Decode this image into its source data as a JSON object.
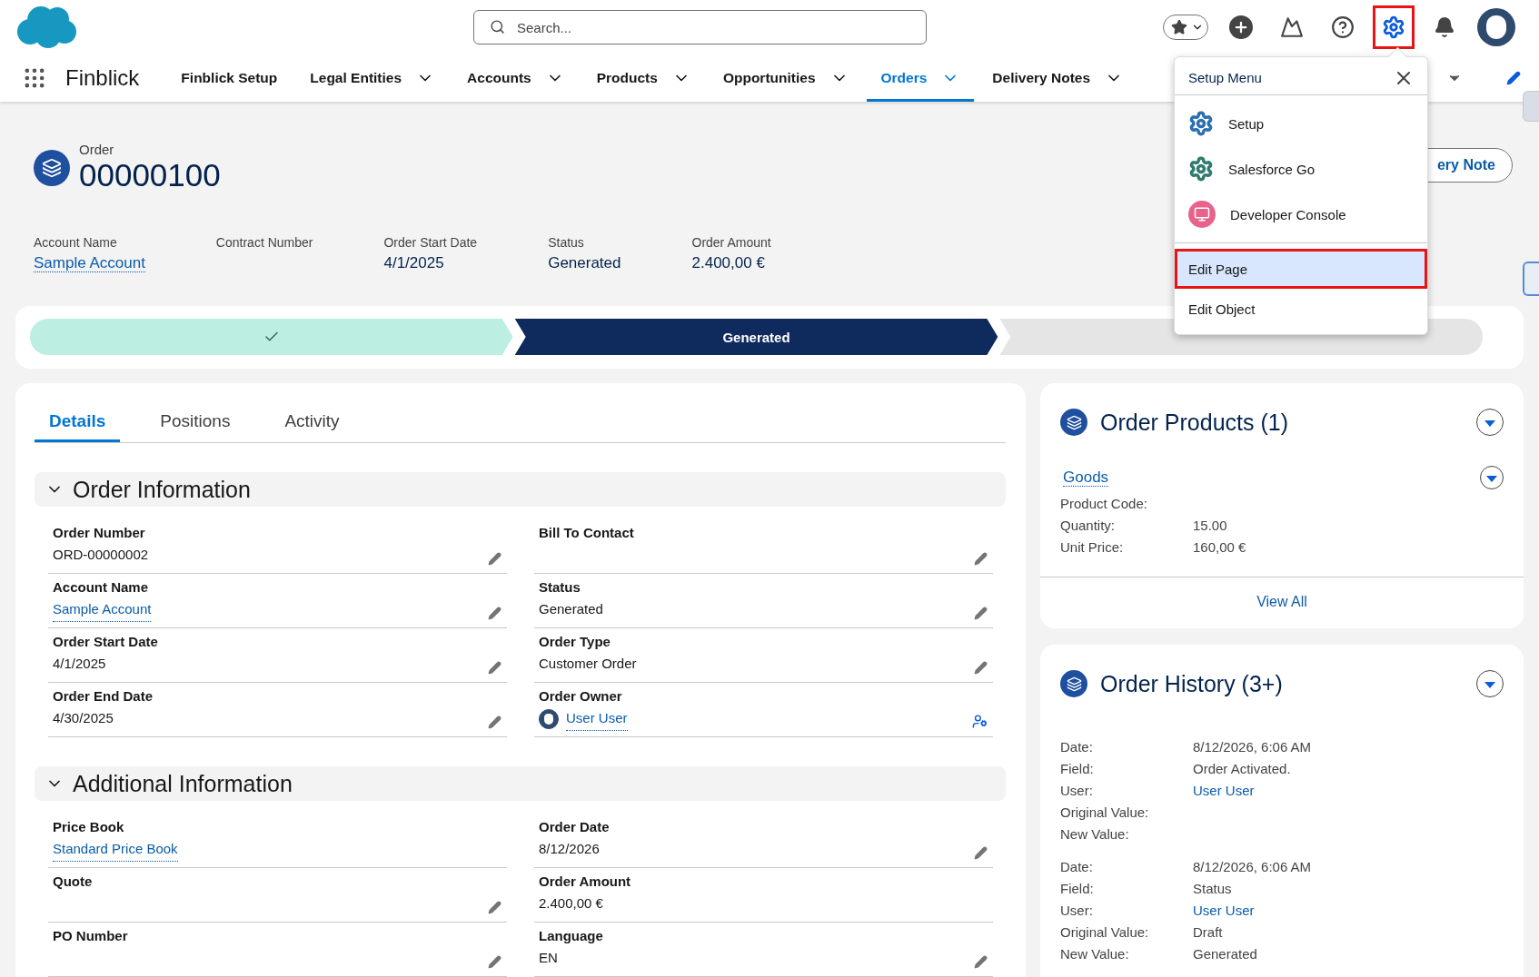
{
  "header": {
    "search": {
      "placeholder": "Search..."
    },
    "setup_highlighted": true
  },
  "nav": {
    "app_name": "Finblick",
    "items": [
      {
        "label": "Finblick Setup",
        "has_menu": false,
        "selected": false
      },
      {
        "label": "Legal Entities",
        "has_menu": true,
        "selected": false
      },
      {
        "label": "Accounts",
        "has_menu": true,
        "selected": false
      },
      {
        "label": "Products",
        "has_menu": true,
        "selected": false
      },
      {
        "label": "Opportunities",
        "has_menu": true,
        "selected": false
      },
      {
        "label": "Orders",
        "has_menu": true,
        "selected": true
      },
      {
        "label": "Delivery Notes",
        "has_menu": true,
        "selected": false
      }
    ]
  },
  "record": {
    "type": "Order",
    "number": "00000100",
    "action": "ery Note",
    "highlights": [
      {
        "label": "Account Name",
        "value": "Sample Account",
        "kind": "link"
      },
      {
        "label": "Contract Number",
        "kind": "empty"
      },
      {
        "label": "Order Start Date",
        "value": "4/1/2025",
        "kind": "text"
      },
      {
        "label": "Status",
        "value": "Generated",
        "kind": "text"
      },
      {
        "label": "Order Amount",
        "value": "2.400,00 €",
        "kind": "text"
      }
    ]
  },
  "path": [
    {
      "complete": true,
      "current": false
    },
    {
      "complete": false,
      "current": true,
      "label": "Generated"
    },
    {
      "complete": false,
      "current": false
    }
  ],
  "tabs": [
    {
      "label": "Details",
      "selected": true
    },
    {
      "label": "Positions",
      "selected": false
    },
    {
      "label": "Activity",
      "selected": false
    }
  ],
  "sections": [
    {
      "title": "Order Information",
      "expanded": true,
      "fields": [
        {
          "label": "Order Number",
          "value": "ORD-00000002",
          "kind": "text",
          "editable": true
        },
        {
          "label": "Bill To Contact",
          "kind": "empty",
          "editable": true
        },
        {
          "label": "Account Name",
          "value": "Sample Account",
          "kind": "link",
          "editable": true
        },
        {
          "label": "Status",
          "value": "Generated",
          "kind": "text",
          "editable": true
        },
        {
          "label": "Order Start Date",
          "value": "4/1/2025",
          "kind": "text",
          "editable": true
        },
        {
          "label": "Order Type",
          "value": "Customer Order",
          "kind": "text",
          "editable": true
        },
        {
          "label": "Order End Date",
          "value": "4/30/2025",
          "kind": "text",
          "editable": true
        },
        {
          "label": "Order Owner",
          "value": "User User",
          "kind": "user",
          "editable": true
        }
      ]
    },
    {
      "title": "Additional Information",
      "expanded": true,
      "fields": [
        {
          "label": "Price Book",
          "value": "Standard Price Book",
          "kind": "link",
          "editable": false
        },
        {
          "label": "Order Date",
          "value": "8/12/2026",
          "kind": "text",
          "editable": true
        },
        {
          "label": "Quote",
          "kind": "empty",
          "editable": true
        },
        {
          "label": "Order Amount",
          "value": "2.400,00 €",
          "kind": "text",
          "editable": false
        },
        {
          "label": "PO Number",
          "kind": "empty",
          "editable": true
        },
        {
          "label": "Language",
          "value": "EN",
          "kind": "text",
          "editable": true
        }
      ]
    }
  ],
  "order_products": {
    "title": "Order Products (1)",
    "items": [
      {
        "name": "Goods",
        "fields": [
          {
            "label": "Product Code:",
            "kind": "empty"
          },
          {
            "label": "Quantity:",
            "value": "15.00",
            "kind": "text"
          },
          {
            "label": "Unit Price:",
            "value": "160,00 €",
            "kind": "text"
          }
        ]
      }
    ],
    "footer": "View All"
  },
  "order_history": {
    "title": "Order History (3+)",
    "entries": [
      {
        "fields": [
          {
            "label": "Date:",
            "value": "8/12/2026, 6:06 AM",
            "kind": "text"
          },
          {
            "label": "Field:",
            "value": "Order Activated.",
            "kind": "text"
          },
          {
            "label": "User:",
            "value": "User User",
            "kind": "link"
          },
          {
            "label": "Original Value:",
            "kind": "empty"
          },
          {
            "label": "New Value:",
            "kind": "empty"
          }
        ]
      },
      {
        "fields": [
          {
            "label": "Date:",
            "value": "8/12/2026, 6:06 AM",
            "kind": "text"
          },
          {
            "label": "Field:",
            "value": "Status",
            "kind": "text"
          },
          {
            "label": "User:",
            "value": "User User",
            "kind": "link"
          },
          {
            "label": "Original Value:",
            "value": "Draft",
            "kind": "text"
          },
          {
            "label": "New Value:",
            "value": "Generated",
            "kind": "text"
          }
        ]
      }
    ]
  },
  "setup_menu": {
    "title": "Setup Menu",
    "groups": [
      [
        {
          "label": "Setup",
          "kind": "setup",
          "highlighted": false
        },
        {
          "label": "Salesforce Go",
          "kind": "go",
          "highlighted": false
        },
        {
          "label": "Developer Console",
          "kind": "console",
          "highlighted": false
        }
      ],
      [
        {
          "label": "Edit Page",
          "kind": "plain",
          "highlighted": true
        },
        {
          "label": "Edit Object",
          "kind": "plain",
          "highlighted": false
        }
      ]
    ]
  }
}
